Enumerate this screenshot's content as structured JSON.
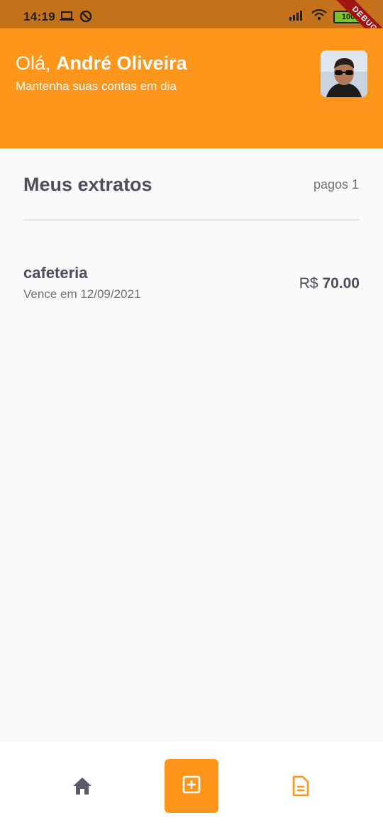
{
  "status_bar": {
    "time": "14:19",
    "battery": "100"
  },
  "debug_banner": "DEBUG",
  "header": {
    "greeting_prefix": "Olá, ",
    "user_name": "André Oliveira",
    "subtitle": "Mantenha suas contas em dia"
  },
  "statements": {
    "title": "Meus extratos",
    "paid_label": "pagos 1",
    "items": [
      {
        "name": "cafeteria",
        "due": "Vence em 12/09/2021",
        "currency": "R$",
        "amount": "70.00"
      }
    ]
  },
  "colors": {
    "primary": "#ff961c",
    "text_dark": "#4f4d5e",
    "text_muted": "#707070",
    "background": "#fafafa"
  },
  "bottom_nav": {
    "items": [
      "home-icon",
      "add-box-icon",
      "description-icon"
    ]
  }
}
